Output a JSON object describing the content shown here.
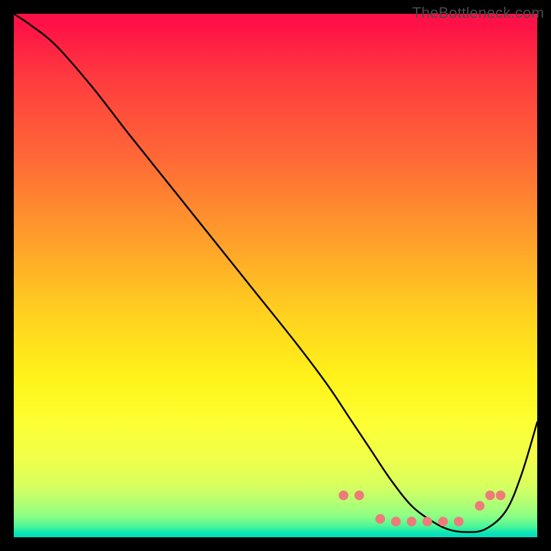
{
  "watermark": "TheBottleneck.com",
  "colors": {
    "curve": "#000000",
    "dots": "#ef7a7a",
    "bg_black": "#000000"
  },
  "chart_data": {
    "type": "line",
    "title": "",
    "xlabel": "",
    "ylabel": "",
    "xlim": [
      0,
      100
    ],
    "ylim": [
      0,
      100
    ],
    "grid": false,
    "legend": false,
    "series": [
      {
        "name": "curve",
        "x": [
          0,
          3,
          8,
          15,
          22,
          30,
          38,
          46,
          54,
          60,
          64,
          68,
          72,
          76,
          80,
          83,
          86,
          90,
          94,
          97,
          100
        ],
        "y": [
          100,
          98,
          94,
          86,
          77,
          67,
          57,
          47,
          37,
          29,
          23,
          17,
          11,
          6,
          3,
          1.5,
          1,
          1.5,
          5,
          12,
          22
        ]
      }
    ],
    "dots": {
      "name": "highlight-dots",
      "x": [
        63,
        66,
        70,
        73,
        76,
        79,
        82,
        85,
        89,
        91,
        93
      ],
      "y": [
        8,
        8,
        3.5,
        3,
        3,
        3,
        3,
        3,
        6,
        8,
        8
      ]
    }
  }
}
